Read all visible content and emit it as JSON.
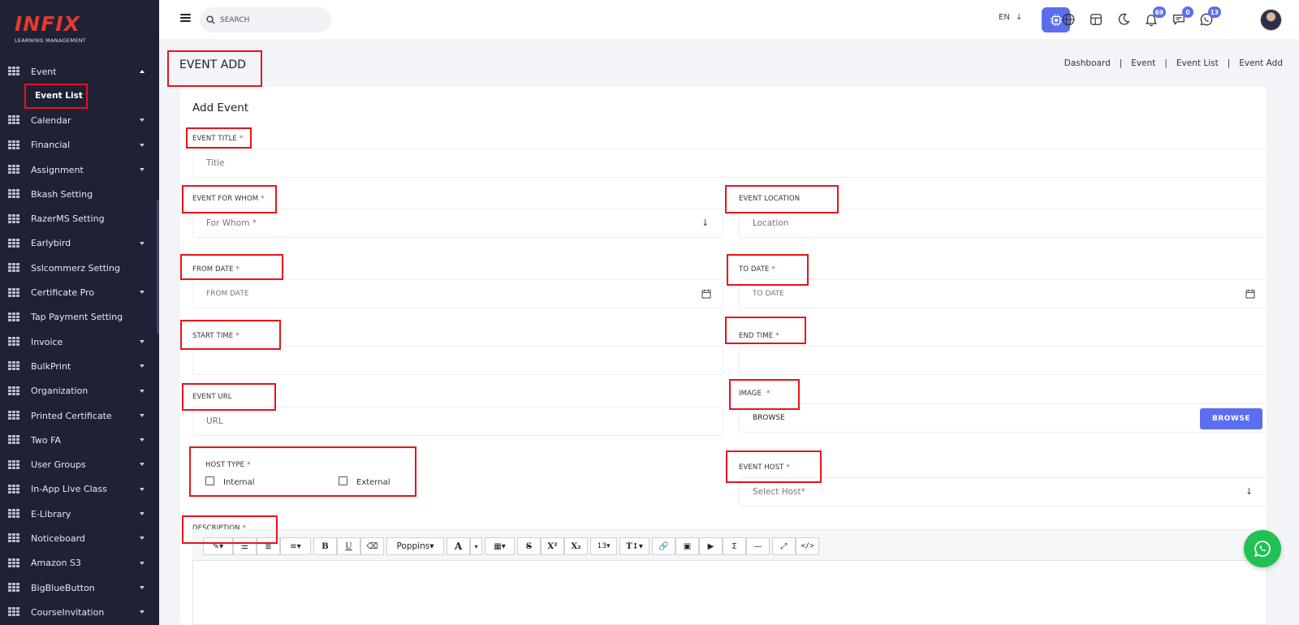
{
  "sidebar": {
    "logo_main": "INFIX",
    "logo_sub": "LEARNING MANAGEMENT",
    "active_menu": "Event",
    "active_submenu": "Event List",
    "items": [
      {
        "label": "Calendar",
        "has_caret": true
      },
      {
        "label": "Financial",
        "has_caret": true
      },
      {
        "label": "Assignment",
        "has_caret": true
      },
      {
        "label": "Bkash Setting",
        "has_caret": false
      },
      {
        "label": "RazerMS Setting",
        "has_caret": false
      },
      {
        "label": "Earlybird",
        "has_caret": true
      },
      {
        "label": "Sslcommerz Setting",
        "has_caret": false
      },
      {
        "label": "Certificate Pro",
        "has_caret": true
      },
      {
        "label": "Tap Payment Setting",
        "has_caret": false
      },
      {
        "label": "Invoice",
        "has_caret": true
      },
      {
        "label": "BulkPrint",
        "has_caret": true
      },
      {
        "label": "Organization",
        "has_caret": true
      },
      {
        "label": "Printed Certificate",
        "has_caret": true
      },
      {
        "label": "Two FA",
        "has_caret": true
      },
      {
        "label": "User Groups",
        "has_caret": true
      },
      {
        "label": "In-App Live Class",
        "has_caret": true
      },
      {
        "label": "E-Library",
        "has_caret": true
      },
      {
        "label": "Noticeboard",
        "has_caret": true
      },
      {
        "label": "Amazon S3",
        "has_caret": true
      },
      {
        "label": "BigBlueButton",
        "has_caret": true
      },
      {
        "label": "CourseInvitation",
        "has_caret": true
      }
    ]
  },
  "topbar": {
    "search_placeholder": "SEARCH",
    "language": "EN",
    "badges": {
      "notifications": "69",
      "messages": "0",
      "whatsapp": "13"
    }
  },
  "page": {
    "title": "EVENT ADD",
    "breadcrumb": [
      "Dashboard",
      "Event",
      "Event List",
      "Event Add"
    ]
  },
  "form": {
    "card_title": "Add Event",
    "event_title_label": "EVENT TITLE",
    "event_title_placeholder": "Title",
    "for_whom_label": "EVENT FOR WHOM",
    "for_whom_placeholder": "For Whom *",
    "location_label": "EVENT LOCATION",
    "location_placeholder": "Location",
    "from_date_label": "FROM DATE",
    "from_date_placeholder": "FROM DATE",
    "to_date_label": "TO DATE",
    "to_date_placeholder": "TO DATE",
    "start_time_label": "START TIME",
    "end_time_label": "END TIME",
    "event_url_label": "EVENT URL",
    "event_url_placeholder": "URL",
    "image_label": "IMAGE",
    "image_value": "BROWSE",
    "browse_button": "BROWSE",
    "host_type_label": "HOST TYPE",
    "host_internal": "Internal",
    "host_external": "External",
    "event_host_label": "EVENT HOST",
    "event_host_placeholder": "Select Host*",
    "description_label": "DESCRIPTION",
    "required_mark": "*"
  },
  "editor_toolbar": {
    "font_name": "Poppins",
    "font_size": "13"
  },
  "colors": {
    "sidebar_bg": "#1f2236",
    "accent": "#5b6ef0",
    "highlight": "#e8141a",
    "required": "#e33322",
    "whatsapp": "#21c254"
  }
}
